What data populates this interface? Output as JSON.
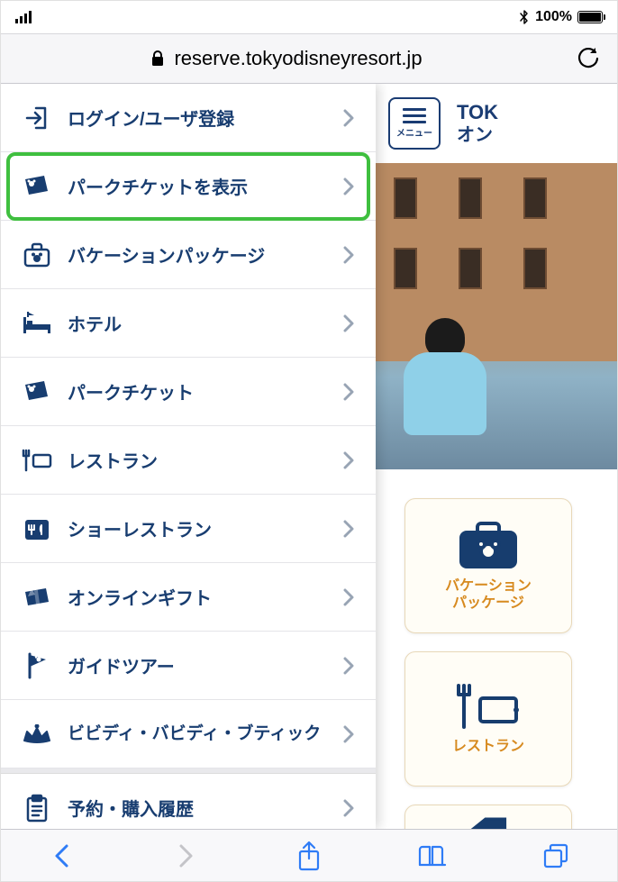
{
  "status": {
    "battery_pct": "100%"
  },
  "browser": {
    "url": "reserve.tokyodisneyresort.jp"
  },
  "header": {
    "menu_label": "メニュー",
    "title_line1": "TOK",
    "title_line2": "オン"
  },
  "drawer": {
    "items": [
      {
        "id": "login",
        "label": "ログイン/ユーザ登録"
      },
      {
        "id": "ticket-show",
        "label": "パークチケットを表示"
      },
      {
        "id": "vacation",
        "label": "バケーションパッケージ"
      },
      {
        "id": "hotel",
        "label": "ホテル"
      },
      {
        "id": "park-ticket",
        "label": "パークチケット"
      },
      {
        "id": "restaurant",
        "label": "レストラン"
      },
      {
        "id": "show-rest",
        "label": "ショーレストラン"
      },
      {
        "id": "online-gift",
        "label": "オンラインギフト"
      },
      {
        "id": "guide-tour",
        "label": "ガイドツアー"
      },
      {
        "id": "bibbidi",
        "label": "ビビディ・バビディ・ブティック"
      },
      {
        "id": "history",
        "label": "予約・購入履歴"
      }
    ]
  },
  "tiles": {
    "vacation": {
      "line1": "バケーション",
      "line2": "パッケージ"
    },
    "restaurant": {
      "label": "レストラン"
    }
  }
}
